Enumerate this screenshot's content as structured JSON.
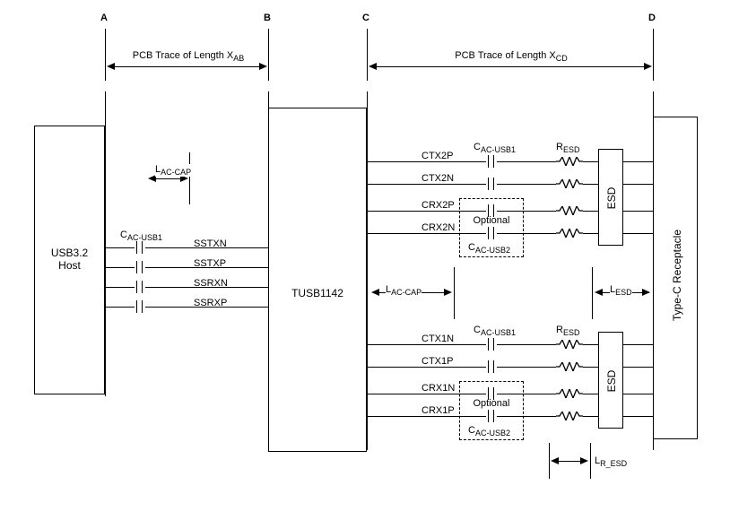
{
  "refs": {
    "A": "A",
    "B": "B",
    "C": "C",
    "D": "D"
  },
  "trace_labels": {
    "ab_pre": "PCB Trace of Length X",
    "ab_sub": "AB",
    "cd_pre": "PCB Trace of Length X",
    "cd_sub": "CD"
  },
  "blocks": {
    "host": "USB3.2\nHost",
    "tusb": "TUSB1142",
    "esd_top": "ESD",
    "esd_bot": "ESD",
    "receptacle": "Type-C\nReceptacle"
  },
  "left_signals": [
    "SSTXN",
    "SSTXP",
    "SSRXN",
    "SSRXP"
  ],
  "right_top_signals": [
    "CTX2P",
    "CTX2N",
    "CRX2P",
    "CRX2N"
  ],
  "right_bot_signals": [
    "CTX1N",
    "CTX1P",
    "CRX1N",
    "CRX1P"
  ],
  "component_labels": {
    "cac_usb1": "C",
    "cac_usb1_sub": "AC-USB1",
    "cac_usb2": "C",
    "cac_usb2_sub": "AC-USB2",
    "resd": "R",
    "resd_sub": "ESD",
    "optional": "Optional"
  },
  "length_labels": {
    "laccap": "L",
    "laccap_sub": "AC-CAP",
    "lesd": "L",
    "lesd_sub": "ESD",
    "lresd": "L",
    "lresd_sub": "R_ESD"
  }
}
